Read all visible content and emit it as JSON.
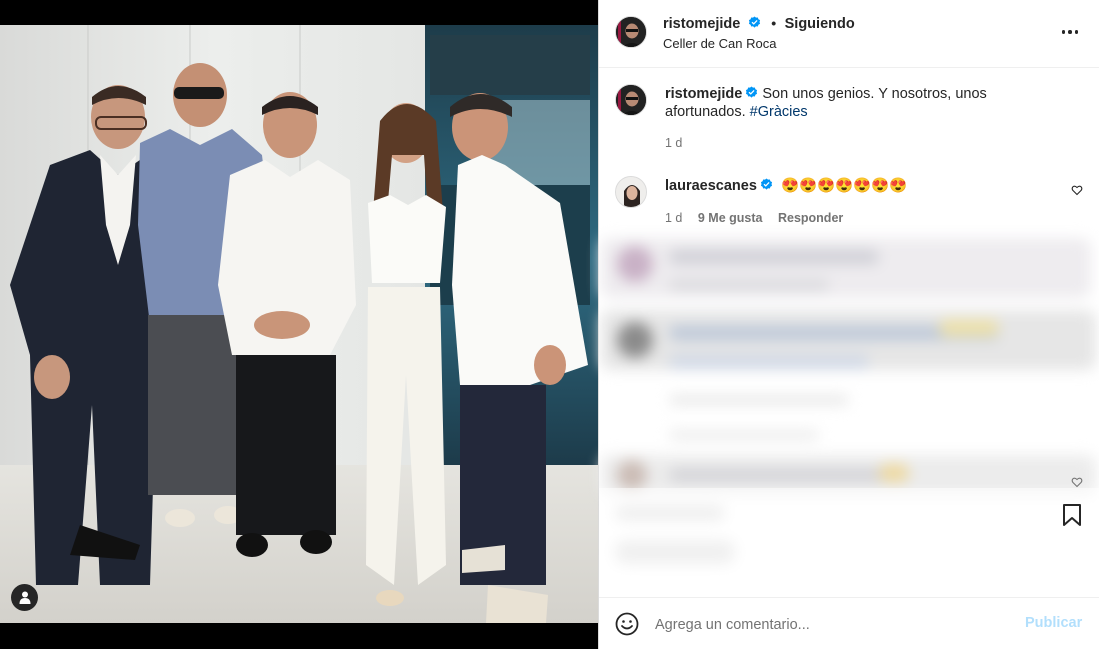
{
  "post": {
    "author": "ristomejide",
    "follow_status": "Siguiendo",
    "location": "Celler de Can Roca",
    "caption": "Son unos genios. Y nosotros, unos afortunados.",
    "hashtag": "#Gràcies",
    "caption_age": "1 d"
  },
  "comment": {
    "author": "lauraescanes",
    "emojis": "😍😍😍😍😍😍😍",
    "age": "1 d",
    "likes": "9 Me gusta",
    "reply_label": "Responder"
  },
  "composer": {
    "placeholder": "Agrega un comentario...",
    "publish_label": "Publicar"
  },
  "icons": {
    "verified": "verified-badge-icon",
    "more": "more-options-icon",
    "heart": "heart-icon",
    "bookmark": "bookmark-icon",
    "emoji": "emoji-icon",
    "tagged_user": "tagged-user-icon"
  },
  "colors": {
    "verified_blue": "#0095f6",
    "link_blue": "#00376b",
    "publish_disabled": "#b2dffc",
    "meta_gray": "#737373"
  }
}
